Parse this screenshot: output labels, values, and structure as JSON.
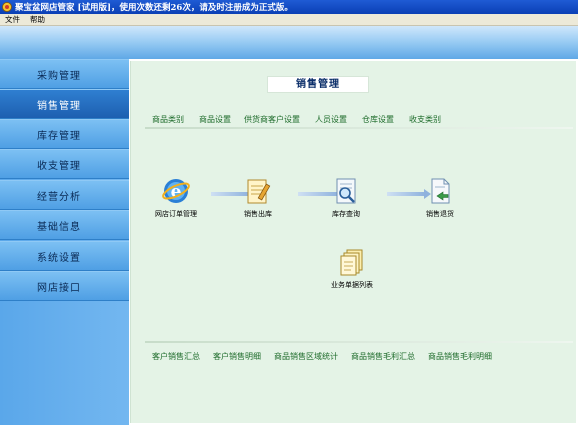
{
  "window": {
    "title": "聚宝盆网店管家 [试用版]，使用次数还剩26次，请及时注册成为正式版。"
  },
  "menu": [
    "文件",
    "帮助"
  ],
  "sidebar": {
    "items": [
      {
        "label": "采购管理"
      },
      {
        "label": "销售管理"
      },
      {
        "label": "库存管理"
      },
      {
        "label": "收支管理"
      },
      {
        "label": "经营分析"
      },
      {
        "label": "基础信息"
      },
      {
        "label": "系统设置"
      },
      {
        "label": "网店接口"
      }
    ],
    "active": "销售管理"
  },
  "main": {
    "title": "销售管理",
    "top_links": [
      "商品类别",
      "商品设置",
      "供货商客户设置",
      "人员设置",
      "仓库设置",
      "收支类别"
    ],
    "flow": [
      {
        "label": "网店订单管理",
        "icon": "ie-icon"
      },
      {
        "label": "销售出库",
        "icon": "notepad-pencil-icon"
      },
      {
        "label": "库存查询",
        "icon": "magnifier-document-icon"
      },
      {
        "label": "销售退货",
        "icon": "document-return-icon"
      },
      {
        "label": "业务单据列表",
        "icon": "stacked-documents-icon"
      }
    ],
    "bottom_links": [
      "客户销售汇总",
      "客户销售明细",
      "商品销售区域统计",
      "商品销售毛利汇总",
      "商品销售毛利明细"
    ]
  },
  "colors": {
    "sidebar": "#5aa7ea",
    "active": "#1d5fb0",
    "panel": "#e4f3e6",
    "link": "#1d6b2a"
  }
}
